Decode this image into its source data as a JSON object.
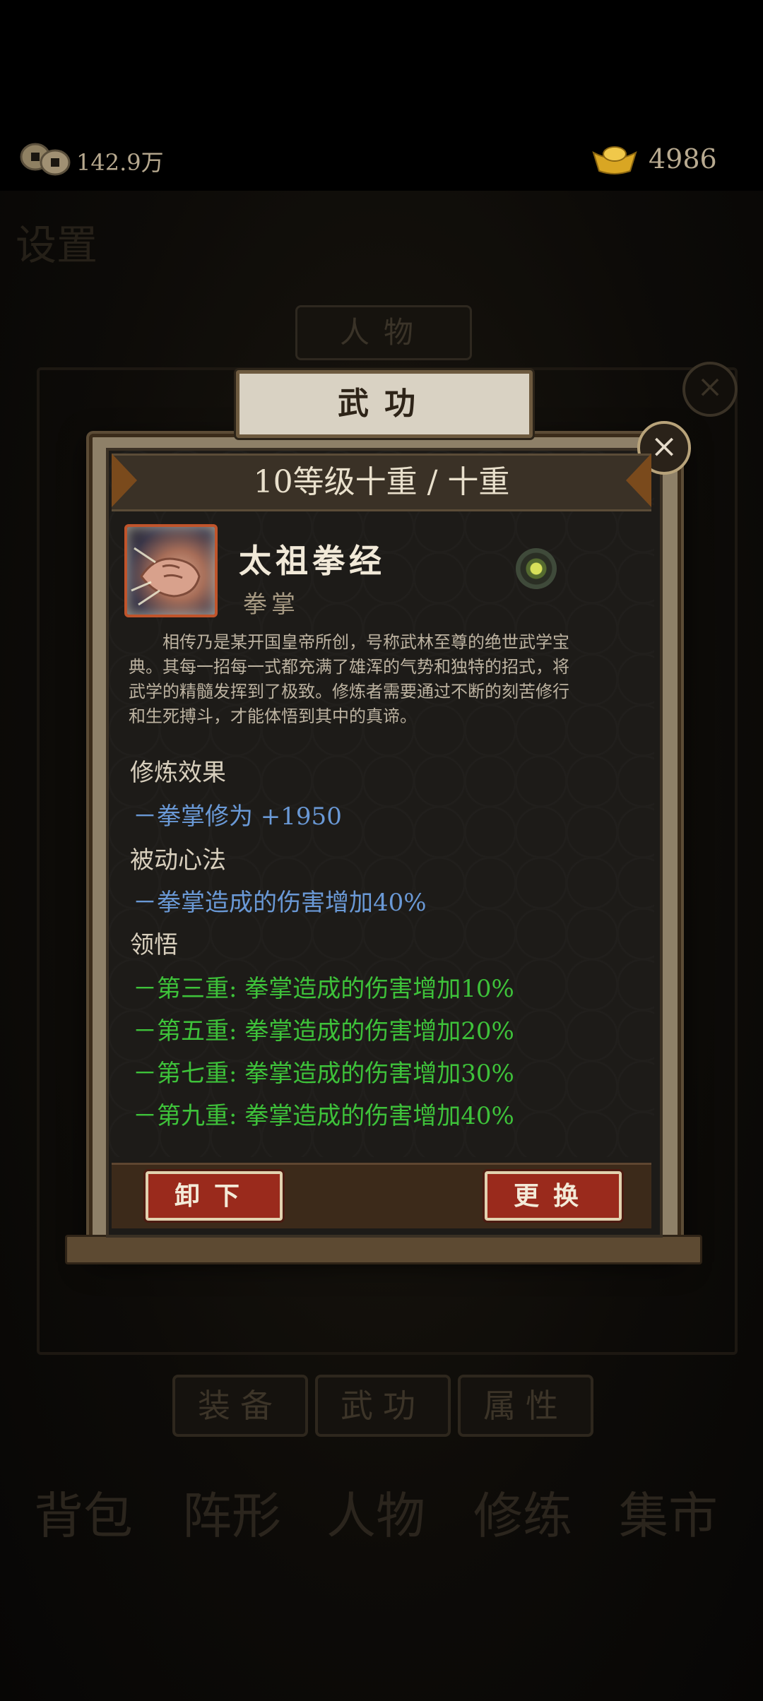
{
  "topbar": {
    "coins": "142.9万",
    "ingots": "4986"
  },
  "background": {
    "settings_text": "设置",
    "character_button": "人物",
    "tabs": [
      "装备",
      "武功",
      "属性"
    ],
    "bottom_nav": [
      "背包",
      "阵形",
      "人物",
      "修练",
      "集市"
    ]
  },
  "dialog": {
    "title": "武功",
    "level": "10等级十重 / 十重",
    "skill_name": "太祖拳经",
    "skill_type": "拳掌",
    "description": "相传乃是某开国皇帝所创，号称武林至尊的绝世武学宝典。其每一招每一式都充满了雄浑的气势和独特的招式，将武学的精髓发挥到了极致。修炼者需要通过不断的刻苦修行和生死搏斗，才能体悟到其中的真谛。",
    "sections": {
      "training_title": "修炼效果",
      "training_line": "－拳掌修为 +1950",
      "passive_title": "被动心法",
      "passive_line": "－拳掌造成的伤害增加40%",
      "insight_title": "领悟",
      "insight_lines": [
        "－第三重: 拳掌造成的伤害增加10%",
        "－第五重: 拳掌造成的伤害增加20%",
        "－第七重: 拳掌造成的伤害增加30%",
        "－第九重: 拳掌造成的伤害增加40%"
      ]
    },
    "buttons": {
      "unequip": "卸下",
      "replace": "更换"
    }
  }
}
